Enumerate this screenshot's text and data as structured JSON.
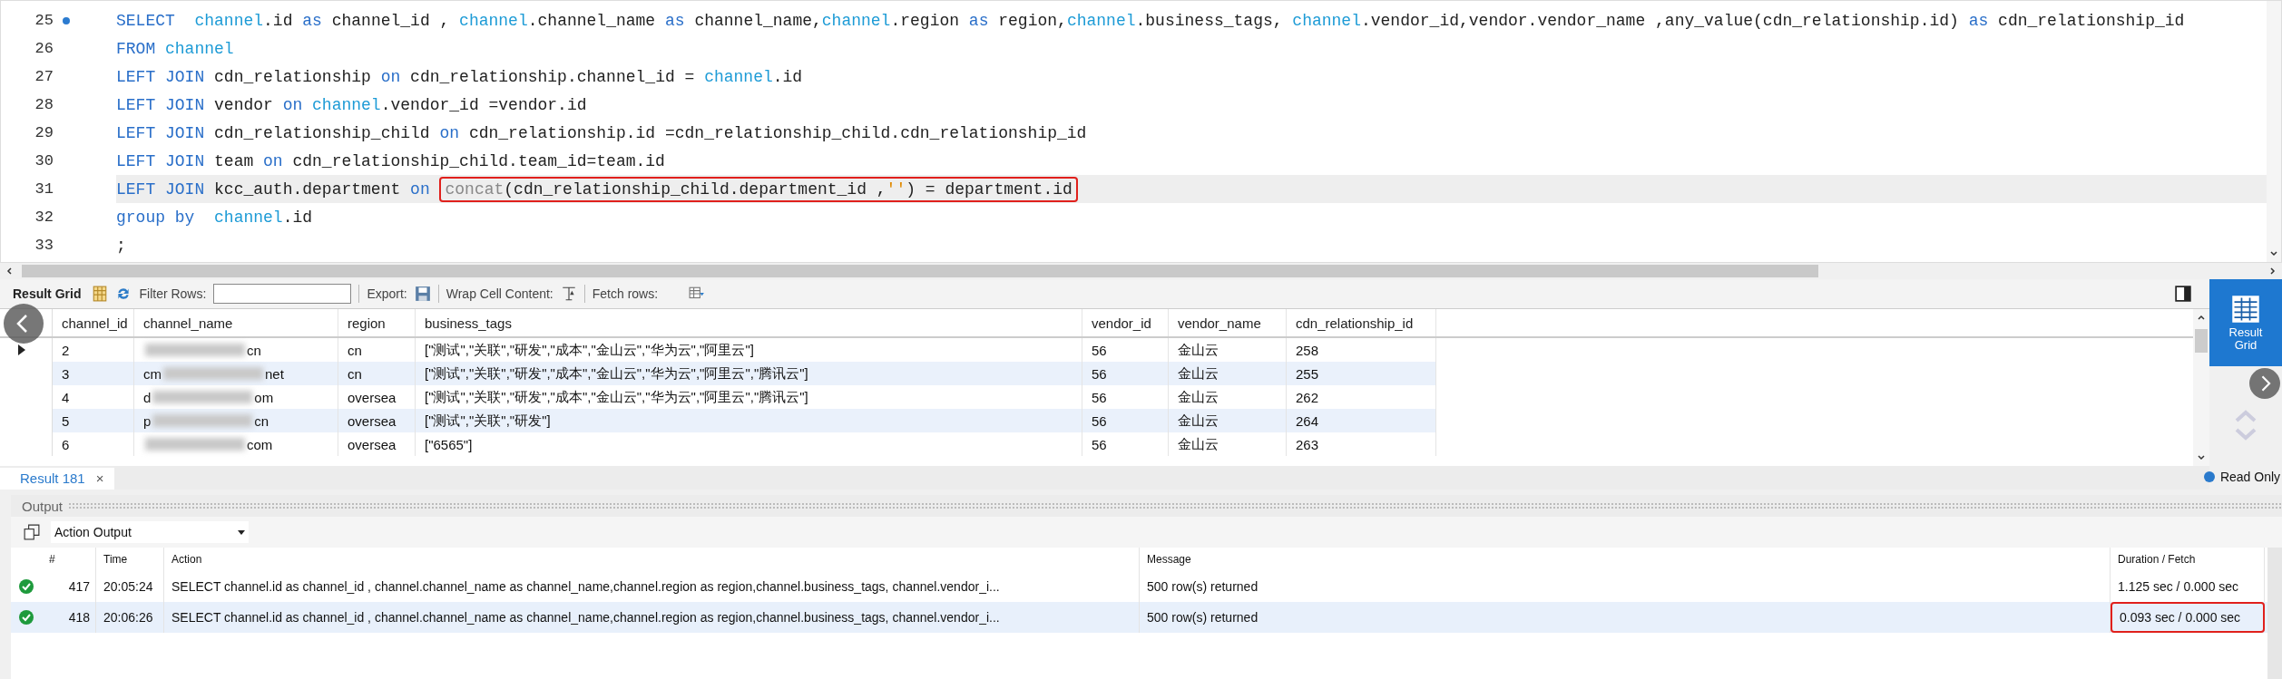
{
  "editor": {
    "lines": [
      {
        "number": "25",
        "marker": true,
        "current": false,
        "tokens": [
          {
            "kind": "keyword",
            "text": "SELECT  "
          },
          {
            "kind": "table",
            "text": "channel"
          },
          {
            "kind": "plain",
            "text": ".id "
          },
          {
            "kind": "keyword",
            "text": "as"
          },
          {
            "kind": "plain",
            "text": " channel_id , "
          },
          {
            "kind": "table",
            "text": "channel"
          },
          {
            "kind": "plain",
            "text": ".channel_name "
          },
          {
            "kind": "keyword",
            "text": "as"
          },
          {
            "kind": "plain",
            "text": " channel_name,"
          },
          {
            "kind": "table",
            "text": "channel"
          },
          {
            "kind": "plain",
            "text": ".region "
          },
          {
            "kind": "keyword",
            "text": "as"
          },
          {
            "kind": "plain",
            "text": " region,"
          },
          {
            "kind": "table",
            "text": "channel"
          },
          {
            "kind": "plain",
            "text": ".business_tags, "
          },
          {
            "kind": "table",
            "text": "channel"
          },
          {
            "kind": "plain",
            "text": ".vendor_id,vendor.vendor_name ,any_value(cdn_relationship.id) "
          },
          {
            "kind": "keyword",
            "text": "as"
          },
          {
            "kind": "plain",
            "text": " cdn_relationship_id"
          }
        ]
      },
      {
        "number": "26",
        "marker": false,
        "current": false,
        "tokens": [
          {
            "kind": "keyword",
            "text": "FROM "
          },
          {
            "kind": "table",
            "text": "channel"
          }
        ]
      },
      {
        "number": "27",
        "marker": false,
        "current": false,
        "tokens": [
          {
            "kind": "keyword",
            "text": "LEFT JOIN "
          },
          {
            "kind": "plain",
            "text": "cdn_relationship "
          },
          {
            "kind": "keyword",
            "text": "on"
          },
          {
            "kind": "plain",
            "text": " cdn_relationship.channel_id = "
          },
          {
            "kind": "table",
            "text": "channel"
          },
          {
            "kind": "plain",
            "text": ".id"
          }
        ]
      },
      {
        "number": "28",
        "marker": false,
        "current": false,
        "tokens": [
          {
            "kind": "keyword",
            "text": "LEFT JOIN "
          },
          {
            "kind": "plain",
            "text": "vendor "
          },
          {
            "kind": "keyword",
            "text": "on "
          },
          {
            "kind": "table",
            "text": "channel"
          },
          {
            "kind": "plain",
            "text": ".vendor_id =vendor.id"
          }
        ]
      },
      {
        "number": "29",
        "marker": false,
        "current": false,
        "tokens": [
          {
            "kind": "keyword",
            "text": "LEFT JOIN "
          },
          {
            "kind": "plain",
            "text": "cdn_relationship_child "
          },
          {
            "kind": "keyword",
            "text": "on"
          },
          {
            "kind": "plain",
            "text": " cdn_relationship.id =cdn_relationship_child.cdn_relationship_id"
          }
        ]
      },
      {
        "number": "30",
        "marker": false,
        "current": false,
        "tokens": [
          {
            "kind": "keyword",
            "text": "LEFT JOIN "
          },
          {
            "kind": "plain",
            "text": "team "
          },
          {
            "kind": "keyword",
            "text": "on"
          },
          {
            "kind": "plain",
            "text": " cdn_relationship_child.team_id=team.id"
          }
        ]
      },
      {
        "number": "31",
        "marker": false,
        "current": true,
        "tokens": [
          {
            "kind": "keyword",
            "text": "LEFT JOIN "
          },
          {
            "kind": "plain",
            "text": "kcc_auth.department "
          },
          {
            "kind": "keyword",
            "text": "on "
          }
        ],
        "boxed_tokens": [
          {
            "kind": "function",
            "text": "concat"
          },
          {
            "kind": "plain",
            "text": "(cdn_relationship_child.department_id ,"
          },
          {
            "kind": "string",
            "text": "''"
          },
          {
            "kind": "plain",
            "text": ") = department.id"
          }
        ]
      },
      {
        "number": "32",
        "marker": false,
        "current": false,
        "tokens": [
          {
            "kind": "keyword",
            "text": "group by  "
          },
          {
            "kind": "table",
            "text": "channel"
          },
          {
            "kind": "plain",
            "text": ".id"
          }
        ]
      },
      {
        "number": "33",
        "marker": false,
        "current": false,
        "tokens": [
          {
            "kind": "plain",
            "text": ";"
          }
        ]
      }
    ]
  },
  "result_toolbar": {
    "title": "Result Grid",
    "filter_label": "Filter Rows:",
    "export_label": "Export:",
    "wrap_label": "Wrap Cell Content:",
    "fetch_label": "Fetch rows:"
  },
  "result_grid": {
    "columns": [
      "channel_id",
      "channel_name",
      "region",
      "business_tags",
      "vendor_id",
      "vendor_name",
      "cdn_relationship_id"
    ],
    "rows": [
      {
        "selected": true,
        "channel_id": "2",
        "name_start": "",
        "name_end": "cn",
        "region": "cn",
        "business_tags": "[\"测试\",\"关联\",\"研发\",\"成本\",\"金山云\",\"华为云\",\"阿里云\"]",
        "vendor_id": "56",
        "vendor_name": "金山云",
        "cdn_relationship_id": "258"
      },
      {
        "selected": false,
        "channel_id": "3",
        "name_start": "cm",
        "name_end": "net",
        "region": "cn",
        "business_tags": "[\"测试\",\"关联\",\"研发\",\"成本\",\"金山云\",\"华为云\",\"阿里云\",\"腾讯云\"]",
        "vendor_id": "56",
        "vendor_name": "金山云",
        "cdn_relationship_id": "255"
      },
      {
        "selected": false,
        "channel_id": "4",
        "name_start": "d",
        "name_end": "om",
        "region": "oversea",
        "business_tags": "[\"测试\",\"关联\",\"研发\",\"成本\",\"金山云\",\"华为云\",\"阿里云\",\"腾讯云\"]",
        "vendor_id": "56",
        "vendor_name": "金山云",
        "cdn_relationship_id": "262"
      },
      {
        "selected": false,
        "channel_id": "5",
        "name_start": "p",
        "name_end": "cn",
        "region": "oversea",
        "business_tags": "[\"测试\",\"关联\",\"研发\"]",
        "vendor_id": "56",
        "vendor_name": "金山云",
        "cdn_relationship_id": "264"
      },
      {
        "selected": false,
        "channel_id": "6",
        "name_start": "",
        "name_end": "com",
        "region": "oversea",
        "business_tags": "[\"6565\"]",
        "vendor_id": "56",
        "vendor_name": "金山云",
        "cdn_relationship_id": "263"
      }
    ]
  },
  "side_panel": {
    "result_grid_label": "Result Grid",
    "read_only": "Read Only"
  },
  "result_tab": {
    "label": "Result 181",
    "close": "×"
  },
  "output": {
    "title": "Output",
    "selector": "Action Output",
    "columns": [
      "#",
      "Time",
      "Action",
      "Message",
      "Duration / Fetch"
    ],
    "rows": [
      {
        "number": "417",
        "time": "20:05:24",
        "action": "SELECT  channel.id as channel_id , channel.channel_name as channel_name,channel.region as region,channel.business_tags, channel.vendor_i...",
        "message": "500 row(s) returned",
        "duration": "1.125 sec / 0.000 sec",
        "boxed": false
      },
      {
        "number": "418",
        "time": "20:06:26",
        "action": "SELECT  channel.id as channel_id , channel.channel_name as channel_name,channel.region as region,channel.business_tags, channel.vendor_i...",
        "message": "500 row(s) returned",
        "duration": "0.093 sec / 0.000 sec",
        "boxed": true
      }
    ]
  }
}
